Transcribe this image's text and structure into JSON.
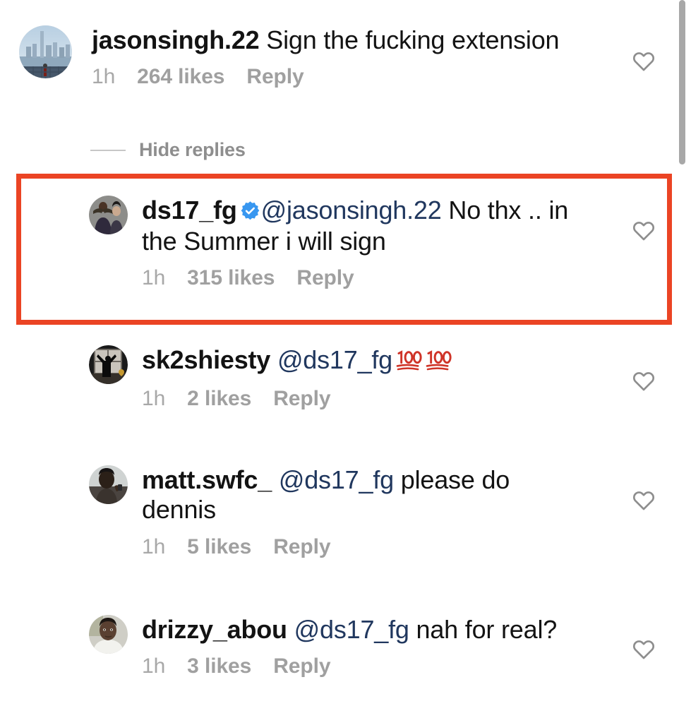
{
  "app": {
    "name": "Instagram comments thread",
    "highlight_color": "#eb4424",
    "mention_color": "#20375e",
    "meta_color": "#a0a0a0",
    "verified_badge_color": "#3897f0"
  },
  "scrollbar": {
    "name": "vertical-scrollbar"
  },
  "comments": [
    {
      "username": "jasonsingh.22",
      "verified": false,
      "mention": "",
      "text": "Sign the fucking extension",
      "emoji": "",
      "time": "1h",
      "likes": "264 likes",
      "reply": "Reply",
      "avatar_alt": "city-skyline-photo"
    },
    {
      "username": "ds17_fg",
      "verified": true,
      "mention": "@jasonsingh.22",
      "text": "No thx .. in the Summer i will sign",
      "emoji": "",
      "time": "1h",
      "likes": "315 likes",
      "reply": "Reply",
      "avatar_alt": "two-people-photo"
    },
    {
      "username": "sk2shiesty",
      "verified": false,
      "mention": "@ds17_fg",
      "text": "",
      "emoji": "100 100",
      "time": "1h",
      "likes": "2 likes",
      "reply": "Reply",
      "avatar_alt": "silhouette-window-photo"
    },
    {
      "username": "matt.swfc_",
      "verified": false,
      "mention": "@ds17_fg",
      "text": "please do dennis",
      "emoji": "",
      "time": "1h",
      "likes": "5 likes",
      "reply": "Reply",
      "avatar_alt": "person-dark-photo"
    },
    {
      "username": "drizzy_abou",
      "verified": false,
      "mention": "@ds17_fg",
      "text": "nah for real?",
      "emoji": "",
      "time": "1h",
      "likes": "3 likes",
      "reply": "Reply",
      "avatar_alt": "person-white-shirt-photo"
    }
  ],
  "hide_replies": {
    "label": "Hide replies"
  },
  "like_buttons": {
    "icon": "heart-icon",
    "count": 5
  }
}
